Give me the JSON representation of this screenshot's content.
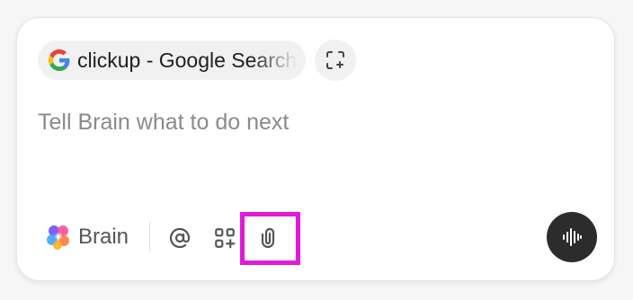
{
  "context_chip": {
    "favicon": "google-g-icon",
    "label": "clickup - Google Search"
  },
  "capture_button": {
    "icon": "screenshot-plus-icon"
  },
  "composer": {
    "placeholder": "Tell Brain what to do next"
  },
  "toolbar": {
    "brain_label": "Brain",
    "brain_icon": "brain-logo-icon",
    "mention_icon": "at-sign-icon",
    "apps_icon": "apps-grid-icon",
    "attach_icon": "paperclip-icon",
    "voice_icon": "voice-waveform-icon"
  },
  "colors": {
    "highlight": "#e21adb",
    "voice_button": "#2c2c2c",
    "placeholder": "#8a8a8a"
  }
}
